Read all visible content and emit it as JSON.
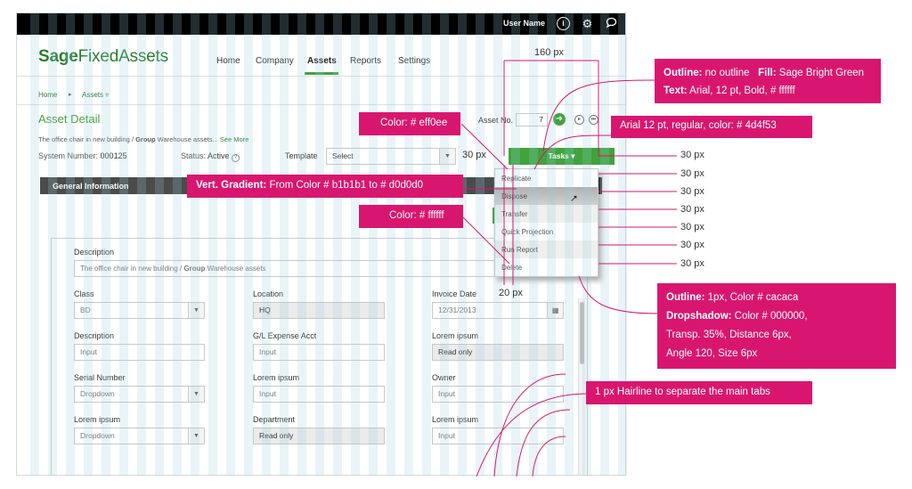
{
  "topbar": {
    "user_name": "User Name",
    "info_icon": "info-icon",
    "gear_icon": "gear-icon",
    "chat_icon": "chat-bubble-icon"
  },
  "brand": {
    "part1": "Sage",
    "part2": "FixedAssets",
    "color": "#2a7d2e"
  },
  "nav": {
    "items": [
      "Home",
      "Company",
      "Assets",
      "Reports",
      "Settings"
    ],
    "active": "Assets"
  },
  "breadcrumb": {
    "home": "Home",
    "assets": "Assets ▿"
  },
  "page": {
    "title": "Asset Detail",
    "description": "The office chair in new building / ",
    "description_bold": "Group",
    "description_tail": " Warehouse assets...",
    "see_more": "See More",
    "system_number_label": "System Number:",
    "system_number": "000125",
    "status_label": "Status:",
    "status": "Active",
    "template_label": "Template",
    "template_value": "Select",
    "asset_no_label": "Asset No.",
    "asset_no_value": "7"
  },
  "tasks": {
    "label": "Tasks ▾",
    "menu": [
      "Replicate",
      "Dispose",
      "Transfer",
      "Quick Projection",
      "Run Report",
      "Delete"
    ]
  },
  "section": {
    "title": "General Information"
  },
  "form": {
    "description_label": "Description",
    "description_value": "The office chair in new building / ",
    "description_bold": "Group",
    "description_tail": " Warehouse assets",
    "class_label": "Class",
    "class_value": "BD",
    "location_label": "Location",
    "location_value": "HQ",
    "invoice_label": "Invoice Date",
    "invoice_value": "12/31/2013",
    "desc2_label": "Description",
    "desc2_placeholder": "Input",
    "gl_label": "G/L Expense Acct",
    "gl_placeholder": "Input",
    "lorem1_label": "Lorem ipsum",
    "lorem1_value": "Read only",
    "serial_label": "Serial Number",
    "serial_value": "Dropdown",
    "lorem2_label": "Lorem ipsum",
    "lorem2_placeholder": "Input",
    "owner_label": "Owner",
    "owner_placeholder": "Input",
    "lorem3_label": "Lorem ipsum",
    "lorem3_value": "Dropdown",
    "dept_label": "Department",
    "dept_value": "Read only",
    "lorem4_label": "Lorem ipsum",
    "lorem4_placeholder": "Input"
  },
  "annotations": {
    "a1_o": "Outline:",
    "a1_o2": " no outline",
    "a1_f": "Fill:",
    "a1_f2": " Sage Bright Green",
    "a1_t": "Text:",
    "a1_t2": " Arial, 12 pt,  Bold, # ffffff",
    "a2": "Arial 12 pt, regular, color: # 4d4f53",
    "a3": "Color: # eff0ee",
    "a4_b": "Vert. Gradient:",
    "a4": " From Color # b1b1b1 to # d0d0d0",
    "a5": "Color: # ffffff",
    "a6_o": "Outline:",
    "a6_o2": " 1px, Color # cacaca",
    "a6_d": "Dropshadow:",
    "a6_d2": " Color # 000000,",
    "a6_l3": "Transp. 35%, Distance 6px,",
    "a6_l4": "Angle 120, Size 6px",
    "a7": "1 px Hairline to separate  the  main  tabs",
    "px160": "160 px",
    "px30_left": "30 px",
    "px30": "30 px",
    "px20": "20 px",
    "color_pink": "#d9166f"
  }
}
